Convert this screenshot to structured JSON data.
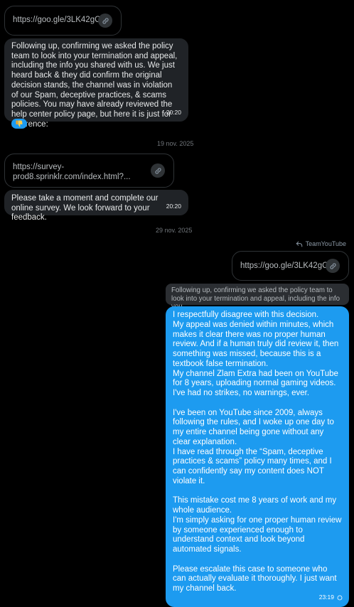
{
  "incoming": {
    "link1": "https://goo.gle/3LK42gC",
    "msg1": "Following up, confirming we asked the policy team to look into your termination and appeal, including the info you shared with us. We just heard back & they did confirm the original decision stands, the channel was in violation of our Spam, deceptive practices, & scams policies. You may have already reviewed the help center policy page, but here it is just for reference:",
    "msg1_time": "20:20",
    "reaction_icon": "thumbs-down",
    "date1": "19 nov. 2025",
    "link2_line1": "https://survey-",
    "link2_line2": "prod8.sprinklr.com/index.html?...",
    "msg2": "Please take a moment and complete our online survey. We look forward to your feedback.",
    "msg2_time": "20:20"
  },
  "date2": "29 nov. 2025",
  "outgoing": {
    "reply_to": "TeamYouTube",
    "quoted_link": "https://goo.gle/3LK42gC",
    "quoted_text": "Following up, confirming we asked the policy team to look into your termination and appeal, including the info you ...",
    "message": "I respectfully disagree with this decision.\nMy appeal was denied within minutes, which makes it clear there was no proper human review. And if a human truly did review it, then something was missed, because this is a textbook false termination.\nMy channel Zlam Extra had been on YouTube for 8 years, uploading normal gaming videos.\nI've had no strikes, no warnings, ever.\n\nI've been on YouTube since 2009, always following the rules, and I woke up one day to my entire channel being gone without any clear explanation.\nI have read through the “Spam, deceptive practices & scams” policy many times, and I can confidently say my content does NOT violate it.\n\nThis mistake cost me 8 years of work and my whole audience.\nI'm simply asking for one proper human review by someone experienced enough to understand context and look beyond automated signals.\n\nPlease escalate this case to someone who can actually evaluate it thoroughly. I just want my channel back.",
    "time": "23:19"
  },
  "colors": {
    "background": "#000000",
    "incoming_bubble": "#202327",
    "outgoing_bubble": "#1d9bf0",
    "muted_text": "#71767b"
  }
}
